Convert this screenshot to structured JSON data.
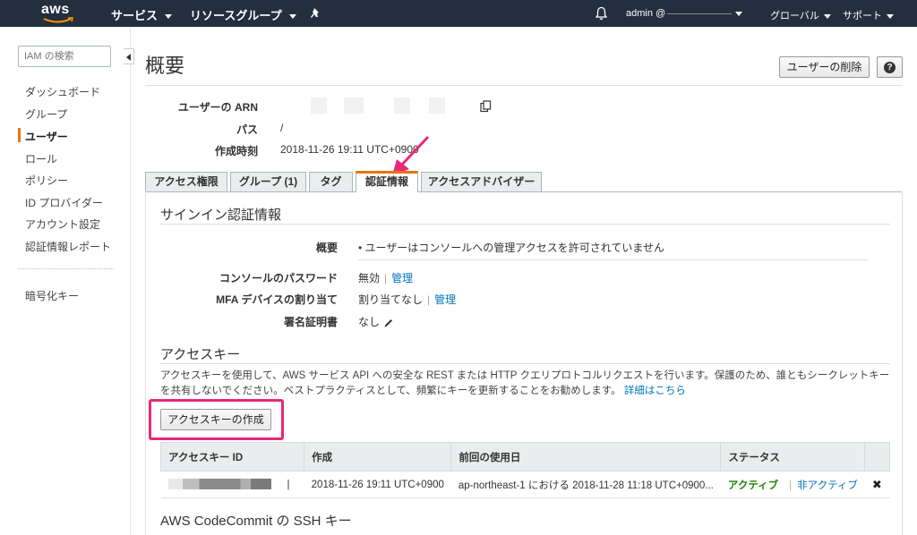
{
  "topnav": {
    "logo": "aws",
    "services": "サービス",
    "resource_groups": "リソースグループ",
    "user": "admin @",
    "region": "グローバル",
    "support": "サポート"
  },
  "sidebar": {
    "search_placeholder": "IAM の検索",
    "items": [
      "ダッシュボード",
      "グループ",
      "ユーザー",
      "ロール",
      "ポリシー",
      "ID プロバイダー",
      "アカウント設定",
      "認証情報レポート"
    ],
    "extra_item": "暗号化キー"
  },
  "page": {
    "title": "概要",
    "delete_button": "ユーザーの削除",
    "help_button": "?"
  },
  "summary": {
    "arn_label": "ユーザーの ARN",
    "path_label": "パス",
    "path_value": "/",
    "created_label": "作成時刻",
    "created_value": "2018-11-26 19:11 UTC+0900"
  },
  "tabs": [
    {
      "label": "アクセス権限"
    },
    {
      "label": "グループ (1)"
    },
    {
      "label": "タグ"
    },
    {
      "label": "認証情報"
    },
    {
      "label": "アクセスアドバイザー"
    }
  ],
  "signin": {
    "title": "サインイン認証情報",
    "summary_label": "概要",
    "summary_value": "• ユーザーはコンソールへの管理アクセスを許可されていません",
    "console_pw_label": "コンソールのパスワード",
    "console_pw_value": "無効",
    "manage": "管理",
    "mfa_label": "MFA デバイスの割り当て",
    "mfa_value": "割り当てなし",
    "cert_label": "署名証明書",
    "cert_value": "なし"
  },
  "access_keys": {
    "title": "アクセスキー",
    "description": "アクセスキーを使用して、AWS サービス API への安全な REST または HTTP クエリプロトコルリクエストを行います。保護のため、誰ともシークレットキーを共有しないでください。ベストプラクティスとして、頻繁にキーを更新することをお勧めします。",
    "details_link": "詳細はこちら",
    "create_button": "アクセスキーの作成",
    "columns": [
      "アクセスキー ID",
      "作成",
      "前回の使用日",
      "ステータス"
    ],
    "rows": [
      {
        "created": "2018-11-26 19:11 UTC+0900",
        "last_used": "ap-northeast-1 における 2018-11-28 11:18 UTC+0900...",
        "status": "アクティブ",
        "deactivate": "非アクティブ"
      }
    ]
  },
  "codecommit": {
    "title": "AWS CodeCommit の SSH キー"
  },
  "colors": {
    "nav_bg": "#232f3e",
    "accent": "#ec7211",
    "highlight": "#e8287a",
    "link": "#0073bb",
    "active_status": "#1d8102"
  }
}
